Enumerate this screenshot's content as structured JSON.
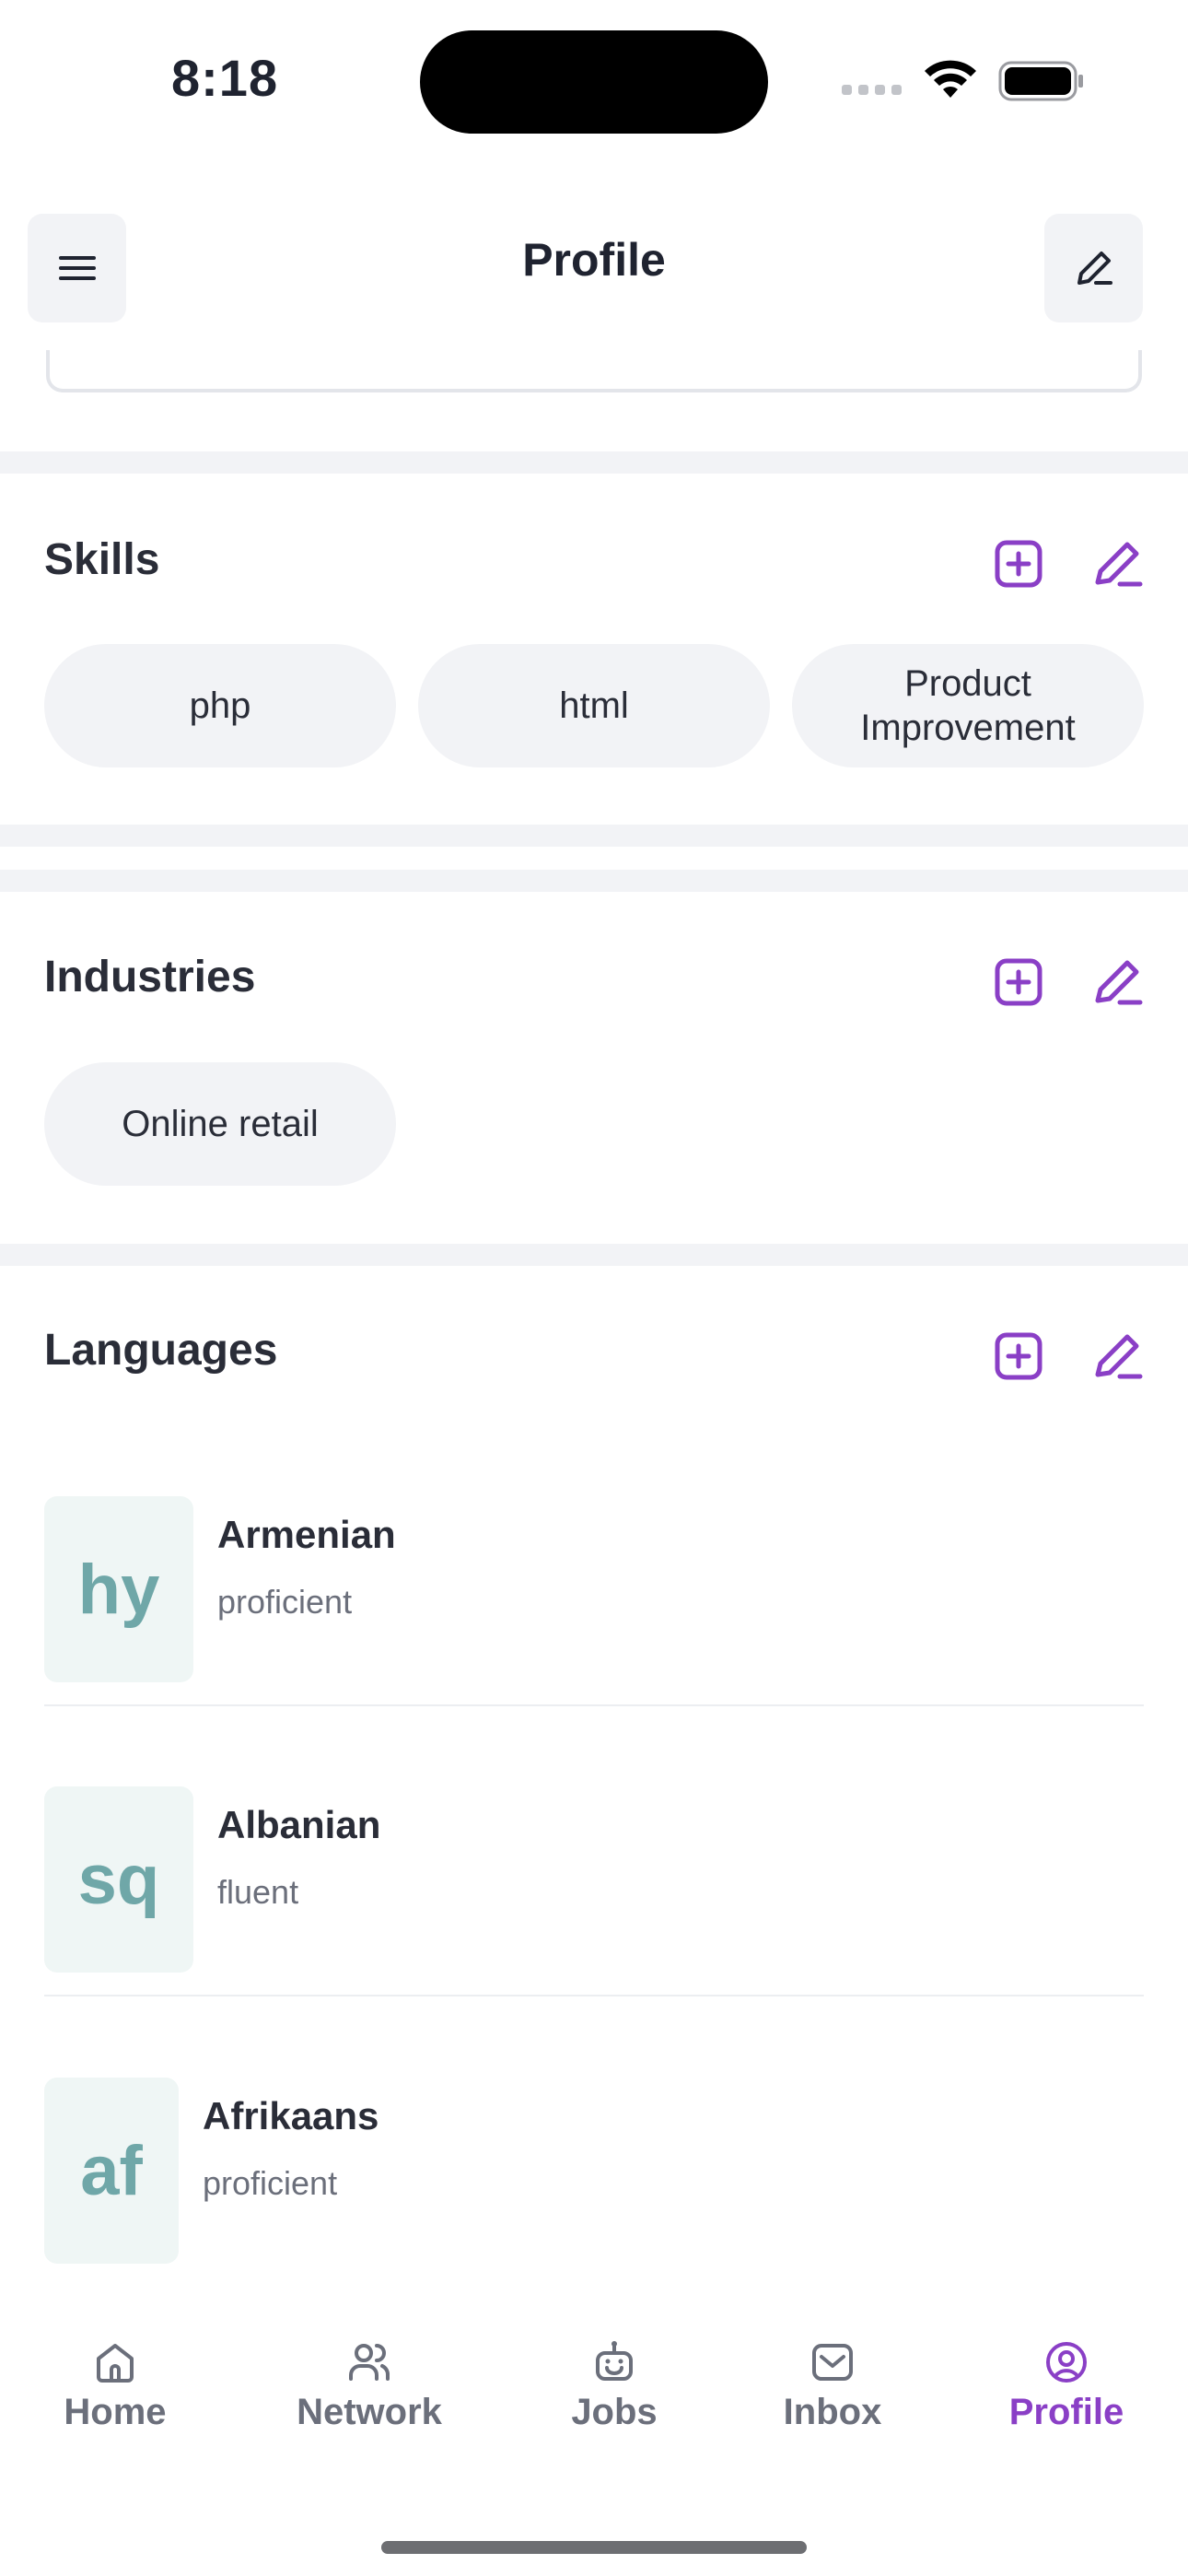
{
  "status": {
    "time": "8:18"
  },
  "header": {
    "title": "Profile"
  },
  "skills": {
    "title": "Skills",
    "items": [
      "php",
      "html",
      "Product Improvement"
    ]
  },
  "industries": {
    "title": "Industries",
    "items": [
      "Online retail"
    ]
  },
  "languages": {
    "title": "Languages",
    "items": [
      {
        "code": "hy",
        "name": "Armenian",
        "level": "proficient"
      },
      {
        "code": "sq",
        "name": "Albanian",
        "level": "fluent"
      },
      {
        "code": "af",
        "name": "Afrikaans",
        "level": "proficient"
      }
    ]
  },
  "nav": {
    "items": [
      {
        "label": "Home",
        "icon": "home-icon"
      },
      {
        "label": "Network",
        "icon": "users-icon"
      },
      {
        "label": "Jobs",
        "icon": "robot-icon"
      },
      {
        "label": "Inbox",
        "icon": "inbox-icon"
      },
      {
        "label": "Profile",
        "icon": "user-circle-icon"
      }
    ],
    "active": "Profile"
  },
  "colors": {
    "accent": "#8a3fc6",
    "chip_bg": "#f2f3f6",
    "badge_bg": "#eff6f5",
    "badge_text": "#6fa7a8"
  }
}
